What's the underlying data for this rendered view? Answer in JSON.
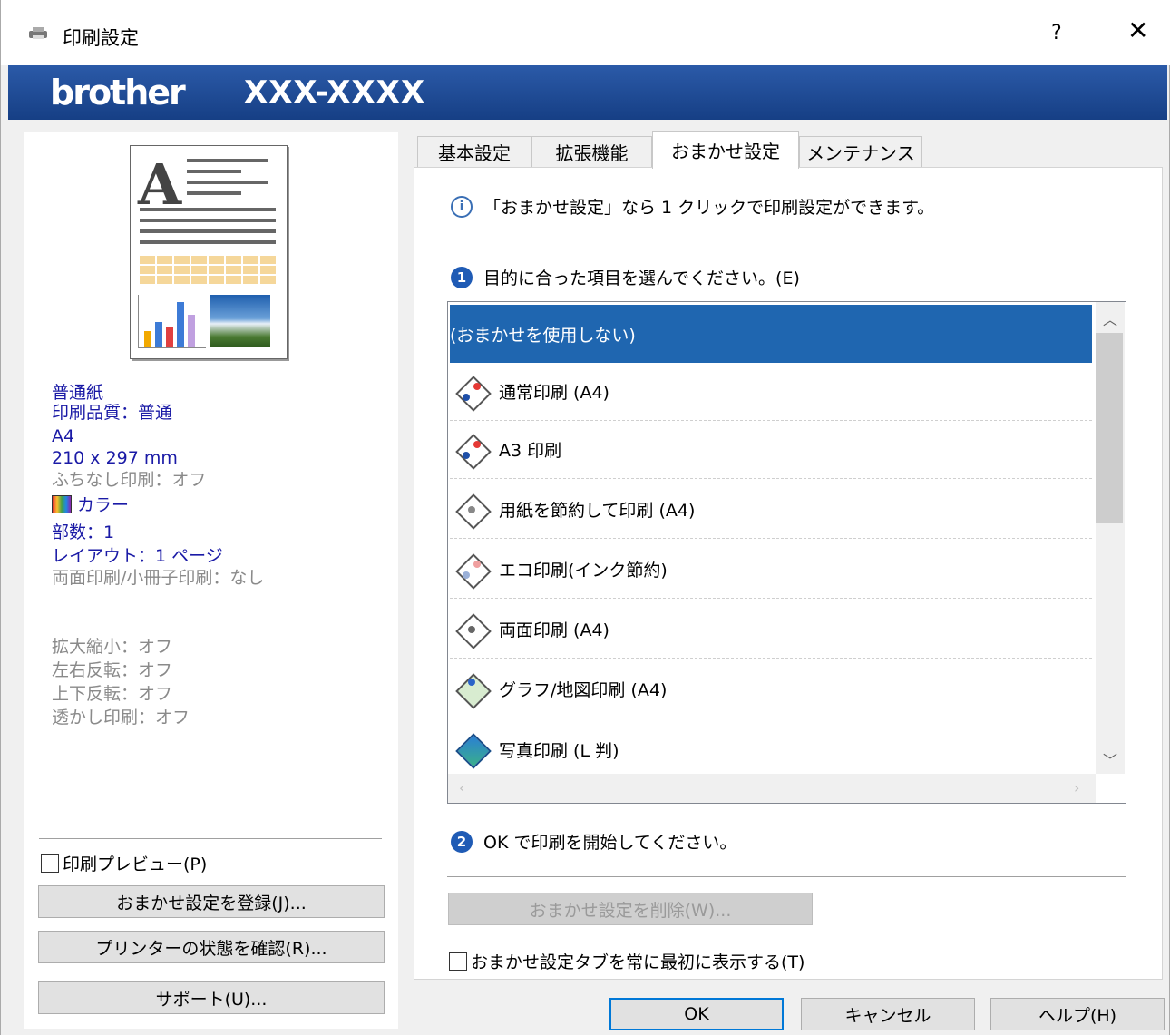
{
  "window": {
    "title": "印刷設定",
    "help_label": "?",
    "close_label": "✕"
  },
  "banner": {
    "brand": "brother",
    "model": "XXX-XXXX"
  },
  "summary": {
    "paper": "普通紙",
    "quality": "印刷品質：普通",
    "size": "A4",
    "dimensions": "210 x 297 mm",
    "borderless": "ふちなし印刷：オフ",
    "color": "カラー",
    "copies": "部数：1",
    "layout": "レイアウト：1 ページ",
    "duplex": "両面印刷/小冊子印刷：なし",
    "scaling": "拡大縮小：オフ",
    "mirror": "左右反転：オフ",
    "reverse": "上下反転：オフ",
    "watermark": "透かし印刷：オフ"
  },
  "left": {
    "preview_checkbox": "印刷プレビュー(P)",
    "register_button": "おまかせ設定を登録(J)...",
    "status_button": "プリンターの状態を確認(R)...",
    "support_button": "サポート(U)..."
  },
  "tabs": [
    "基本設定",
    "拡張機能",
    "おまかせ設定",
    "メンテナンス"
  ],
  "main": {
    "info_text": "「おまかせ設定」なら 1 クリックで印刷設定ができます。",
    "step1_number": "1",
    "step1_text": "目的に合った項目を選んでください。(E)",
    "items": [
      "(おまかせを使用しない)",
      "通常印刷 (A4)",
      "A3 印刷",
      "用紙を節約して印刷 (A4)",
      "エコ印刷(インク節約)",
      "両面印刷 (A4)",
      "グラフ/地図印刷 (A4)",
      "写真印刷 (L 判)"
    ],
    "step2_number": "2",
    "step2_text": "OK で印刷を開始してください。",
    "delete_button": "おまかせ設定を削除(W)...",
    "always_first_checkbox": "おまかせ設定タブを常に最初に表示する(T)"
  },
  "footer": {
    "ok": "OK",
    "cancel": "キャンセル",
    "help": "ヘルプ(H)"
  },
  "colors": {
    "banner": "#1d4a95",
    "selection": "#1f66b0",
    "summary_text": "#1a1aa6",
    "disabled_text": "#8a8a8a"
  }
}
